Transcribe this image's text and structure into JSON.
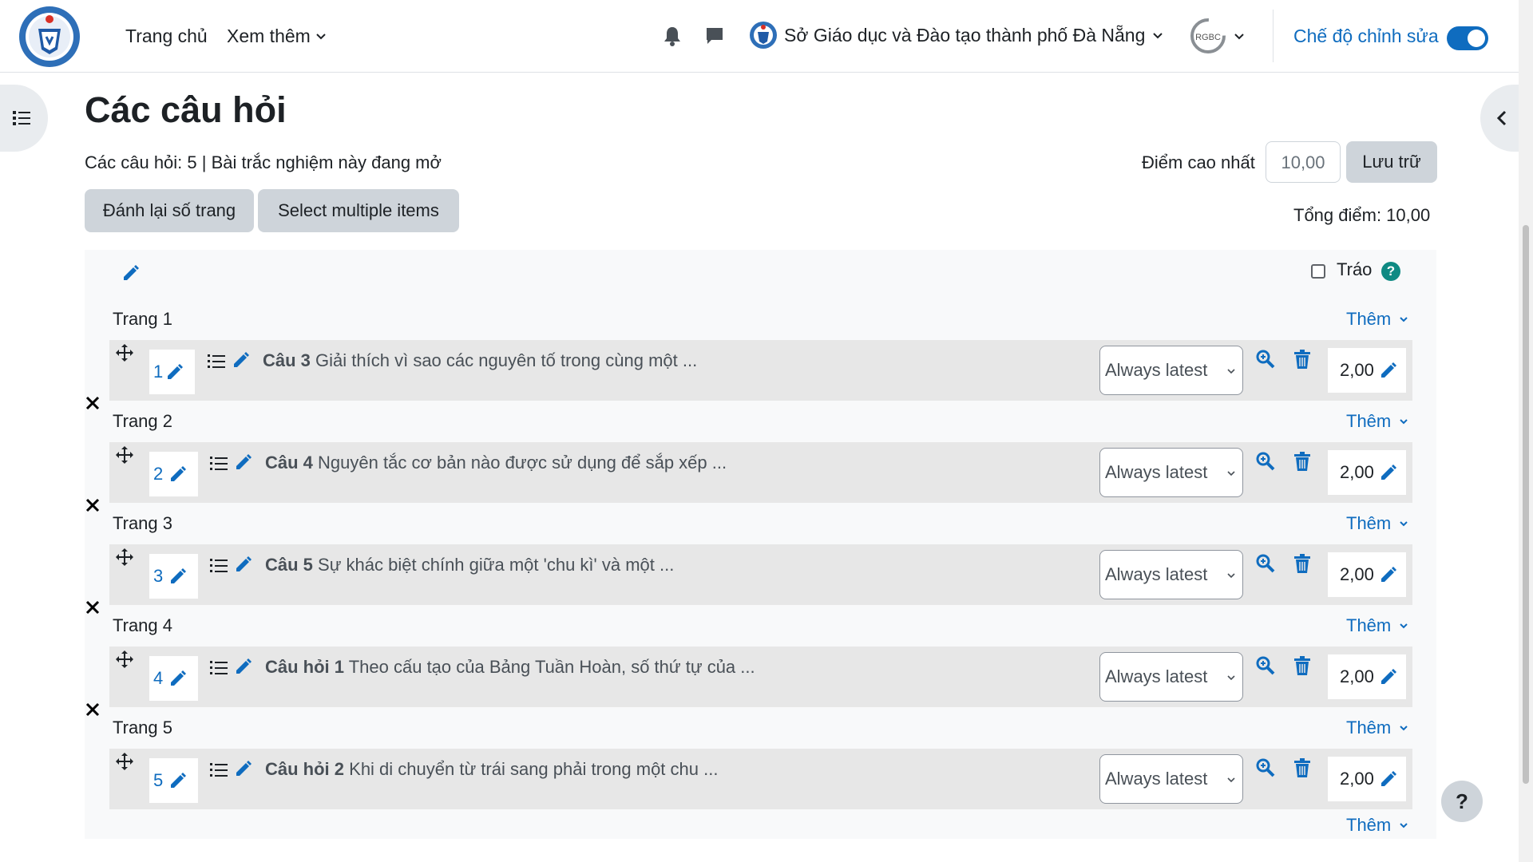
{
  "nav": {
    "home": "Trang chủ",
    "more": "Xem thêm",
    "org_name": "Sở Giáo dục và Đào tạo thành phố Đà Nẵng",
    "user_logo_text": "RGBC",
    "edit_mode_label": "Chế độ chỉnh sửa",
    "edit_mode_on": true
  },
  "page": {
    "title": "Các câu hỏi",
    "info": "Các câu hỏi: 5 | Bài trắc nghiệm này đang mở",
    "repaginate_label": "Đánh lại số trang",
    "select_multiple_label": "Select multiple items",
    "max_grade_label": "Điểm cao nhất",
    "max_grade_value": "10,00",
    "save_label": "Lưu trữ",
    "total_label": "Tổng điểm: 10,00",
    "shuffle_label": "Tráo",
    "help_glyph": "?",
    "fab_help_glyph": "?"
  },
  "sections": [
    {
      "page_label": "Trang 1",
      "more_label": "Thêm",
      "number": "1",
      "qname": "Câu 3",
      "qtext": "Giải thích vì sao các nguyên tố trong cùng một ...",
      "version": "Always latest",
      "mark": "2,00"
    },
    {
      "page_label": "Trang 2",
      "more_label": "Thêm",
      "number": "2",
      "qname": "Câu 4",
      "qtext": "Nguyên tắc cơ bản nào được sử dụng để sắp xếp ...",
      "version": "Always latest",
      "mark": "2,00"
    },
    {
      "page_label": "Trang 3",
      "more_label": "Thêm",
      "number": "3",
      "qname": "Câu 5",
      "qtext": "Sự khác biệt chính giữa một 'chu kì' và một ...",
      "version": "Always latest",
      "mark": "2,00"
    },
    {
      "page_label": "Trang 4",
      "more_label": "Thêm",
      "number": "4",
      "qname": "Câu hỏi 1",
      "qtext": "Theo cấu tạo của Bảng Tuần Hoàn, số thứ tự của ...",
      "version": "Always latest",
      "mark": "2,00"
    },
    {
      "page_label": "Trang 5",
      "more_label": "Thêm",
      "number": "5",
      "qname": "Câu hỏi 2",
      "qtext": "Khi di chuyển từ trái sang phải trong một chu ...",
      "version": "Always latest",
      "mark": "2,00"
    }
  ],
  "footer_more_label": "Thêm",
  "colors": {
    "link": "#0f6cbf",
    "slot_bg": "#e7e7e7",
    "panel_bg": "#f8f9fa",
    "button_bg": "#ced4da"
  }
}
